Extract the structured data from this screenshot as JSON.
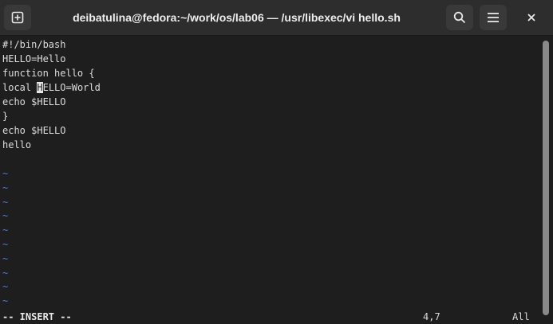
{
  "window": {
    "title": "deibatulina@fedora:~/work/os/lab06 — /usr/libexec/vi hello.sh",
    "new_tab_icon": "new-tab-icon",
    "search_icon": "search-icon",
    "menu_icon": "hamburger-menu-icon",
    "close_icon": "close-icon"
  },
  "editor": {
    "lines": [
      "#!/bin/bash",
      "HELLO=Hello",
      "function hello {",
      "local HELLO=World",
      "echo $HELLO",
      "}",
      "echo $HELLO",
      "hello",
      ""
    ],
    "cursor_line_prefix": "local ",
    "cursor_char": "H",
    "cursor_line_suffix": "ELLO=World",
    "tilde": "~",
    "tilde_count": 10
  },
  "status": {
    "mode": "-- INSERT --",
    "position": "4,7",
    "scroll": "All"
  },
  "colors": {
    "background": "#1e1e1e",
    "text": "#dcdcdc",
    "tilde": "#4a7fc8",
    "titlebar": "#2d2d2d"
  }
}
